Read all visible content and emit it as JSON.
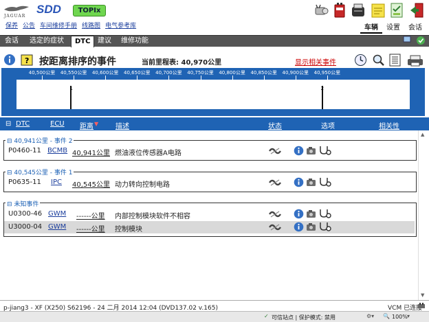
{
  "header": {
    "brand": "JAGUAR",
    "app_name": "SDD",
    "topix_label": "TOPIx",
    "links": [
      "保养",
      "公告",
      "车间维修手册",
      "线路图",
      "电气参考库"
    ],
    "right_tabs": [
      "车辆",
      "设置",
      "会话"
    ]
  },
  "tabs": [
    "会话",
    "选定的症状",
    "DTC",
    "建议",
    "维修功能"
  ],
  "event_header": {
    "title": "按距离排序的事件",
    "mileage_label": "当前里程表: 40,970公里",
    "show_related": "显示相关事件"
  },
  "timeline": {
    "ticks": [
      "40,500公里",
      "40,550公里",
      "40,600公里",
      "40,650公里",
      "40,700公里",
      "40,750公里",
      "40,800公里",
      "40,850公里",
      "40,900公里",
      "40,950公里"
    ],
    "events": [
      {
        "number": "1",
        "distance_km": 40545
      },
      {
        "number": "2",
        "distance_km": 40941
      }
    ]
  },
  "columns": {
    "dtc": "DTC",
    "ecu": "ECU",
    "distance": "距离",
    "description": "描述",
    "status": "状态",
    "options": "选项",
    "relevance": "相关性"
  },
  "groups": [
    {
      "label": "40,941公里 - 事件 2",
      "rows": [
        {
          "dtc": "P0460-11",
          "ecu": "BCMB",
          "distance": "40,941公里",
          "description": "燃油液位传感器A电路"
        }
      ]
    },
    {
      "label": "40,545公里 - 事件 1",
      "rows": [
        {
          "dtc": "P0635-11",
          "ecu": "IPC",
          "distance": "40,545公里",
          "description": "动力转向控制电路"
        }
      ]
    },
    {
      "label": "未知事件",
      "rows": [
        {
          "dtc": "U0300-46",
          "ecu": "GWM",
          "distance": "------公里",
          "description": "内部控制模块软件不相容"
        },
        {
          "dtc": "U3000-04",
          "ecu": "GWM",
          "distance": "------公里",
          "description": "控制模块"
        }
      ]
    }
  ],
  "statusbar": {
    "session": "p-jiang3 - XF (X250) S62196 - 24 二月 2014 12:04 (DVD137.02 v.165)",
    "vcm": "VCM 已连接"
  },
  "ie": {
    "zone": "可信站点 | 保护模式: 禁用",
    "zoom": "100%"
  },
  "colors": {
    "accent_blue": "#1f63b4",
    "tab_dark": "#555555",
    "link_red": "#cc0000"
  }
}
